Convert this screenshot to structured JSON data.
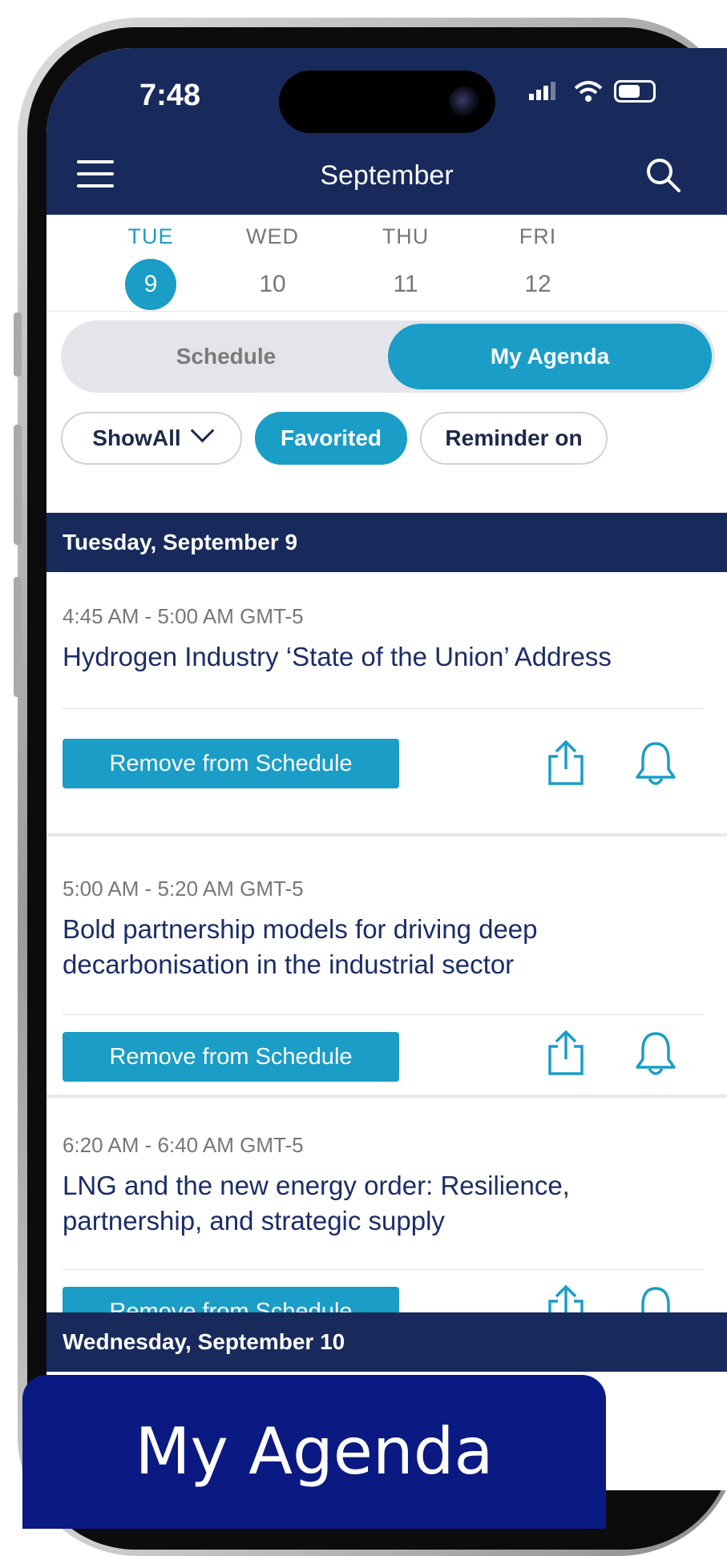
{
  "status_bar": {
    "time": "7:48"
  },
  "nav": {
    "title": "September"
  },
  "days": [
    {
      "dow": "TUE",
      "num": "9",
      "active": true
    },
    {
      "dow": "WED",
      "num": "10",
      "active": false
    },
    {
      "dow": "THU",
      "num": "11",
      "active": false
    },
    {
      "dow": "FRI",
      "num": "12",
      "active": false
    }
  ],
  "segments": {
    "left": "Schedule",
    "right": "My Agenda",
    "selected": "My Agenda"
  },
  "filters": {
    "show_all": "ShowAll",
    "favorited": "Favorited",
    "reminder": "Reminder on"
  },
  "sections": [
    {
      "header": "Tuesday, September 9",
      "sessions": [
        {
          "time": "4:45 AM - 5:00 AM GMT-5",
          "title": "Hydrogen Industry ‘State of the Union’ Address",
          "button": "Remove from Schedule"
        },
        {
          "time": "5:00 AM - 5:20 AM GMT-5",
          "title": "Bold partnership models for driving deep decarbonisation in the industrial sector",
          "button": "Remove from Schedule"
        },
        {
          "time": "6:20 AM - 6:40 AM GMT-5",
          "title": "LNG and the new energy order: Resilience, partnership, and strategic supply",
          "button": "Remove from Schedule"
        }
      ]
    },
    {
      "header": "Wednesday, September 10"
    }
  ],
  "caption": "My Agenda",
  "colors": {
    "navy": "#182a5c",
    "accent": "#1a9dc7",
    "caption_bg": "#0a1a82"
  },
  "icons": {
    "share": "share-icon",
    "reminder": "bell-icon"
  }
}
